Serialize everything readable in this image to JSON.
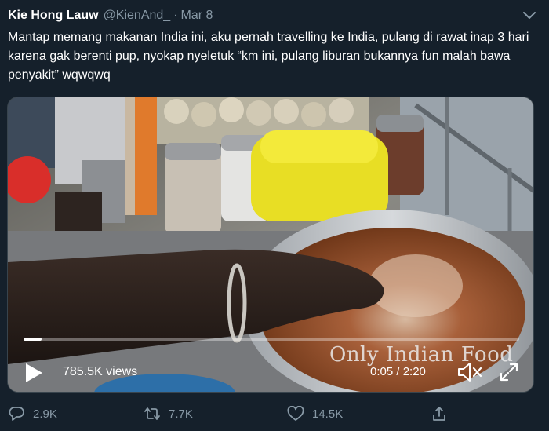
{
  "tweet": {
    "display_name": "Kie Hong Lauw",
    "handle": "@KienAnd_",
    "separator": "·",
    "date": "Mar 8",
    "text": "Mantap memang makanan India ini, aku pernah travelling ke India, pulang di rawat inap 3 hari karena gak berenti pup, nyokap nyeletuk “km ini, pulang liburan bukannya fun malah bawa penyakit” wqwqwq"
  },
  "media": {
    "watermark": "Only Indian Food",
    "views": "785.5K views",
    "time": "0:05 / 2:20",
    "progress": 0.036
  },
  "actions": {
    "reply_count": "2.9K",
    "retweet_count": "7.7K",
    "like_count": "14.5K"
  },
  "icons": {
    "more": "chevron-down-icon",
    "play": "play-icon",
    "volume": "volume-muted-icon",
    "fullscreen": "fullscreen-icon",
    "reply": "reply-icon",
    "retweet": "retweet-icon",
    "like": "heart-icon",
    "share": "share-icon"
  },
  "colors": {
    "background": "#15202b",
    "secondary_text": "#8899a6",
    "border": "#38444d"
  }
}
